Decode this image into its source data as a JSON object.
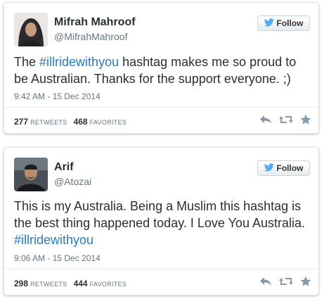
{
  "tweets": [
    {
      "name": "Mifrah Mahroof",
      "handle": "@MifrahMahroof",
      "follow_label": "Follow",
      "text_before": "The ",
      "hashtag": "#illridewithyou",
      "text_after": " hashtag makes me so proud to be Australian. Thanks for the support everyone. ;)",
      "date": "9:42 AM - 15 Dec 2014",
      "retweets": "277",
      "retweets_label": "RETWEETS",
      "favorites": "468",
      "favorites_label": "FAVORITES"
    },
    {
      "name": "Arif",
      "handle": "@Atozai",
      "follow_label": "Follow",
      "text_before": "This is my Australia. Being a Muslim this hashtag is the best thing happened today. I Love You Australia. ",
      "hashtag": "#illridewithyou",
      "text_after": "",
      "date": "9:06 AM - 15 Dec 2014",
      "retweets": "298",
      "retweets_label": "RETWEETS",
      "favorites": "444",
      "favorites_label": "FAVORITES"
    }
  ],
  "colors": {
    "link": "#2b7bb9",
    "twitter_bird": "#55acee",
    "muted": "#66757f",
    "action_icon": "#8899a6"
  },
  "icons": [
    "twitter-bird-icon",
    "reply-icon",
    "retweet-icon",
    "favorite-star-icon"
  ]
}
